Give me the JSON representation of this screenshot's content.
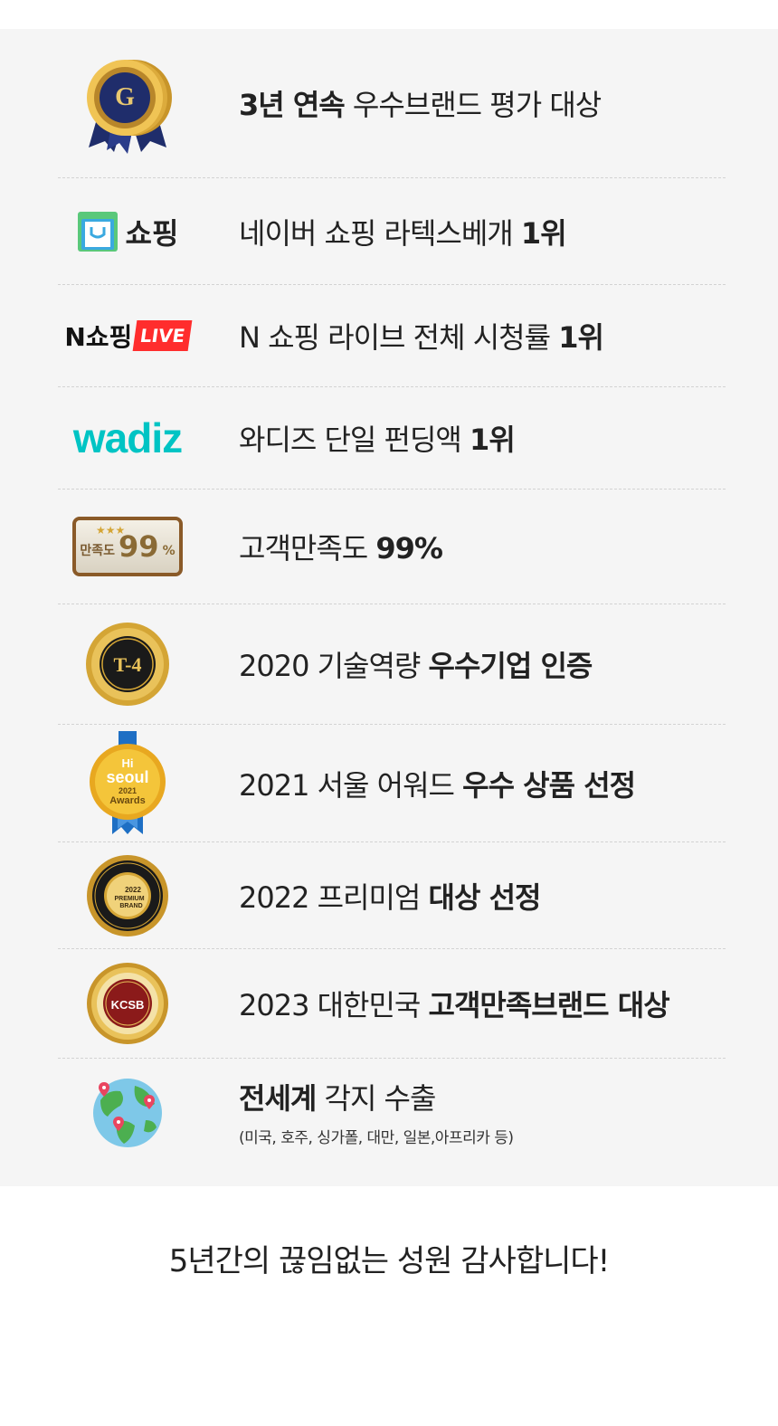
{
  "awards": [
    {
      "icon": "ksba-award-medal-icon",
      "plain_before": "",
      "bold_before": "3년 연속",
      "plain": " 우수브랜드 평가 대상",
      "bold": ""
    },
    {
      "icon": "naver-shopping-logo-icon",
      "icon_text": "쇼핑",
      "plain_before": "",
      "bold_before": "",
      "plain": "네이버 쇼핑 라텍스베개 ",
      "bold": "1위"
    },
    {
      "icon": "n-shopping-live-logo-icon",
      "icon_text": "N쇼핑",
      "icon_badge": "LIVE",
      "plain_before": "",
      "bold_before": "",
      "plain": "N 쇼핑 라이브 전체 시청률 ",
      "bold": "1위"
    },
    {
      "icon": "wadiz-logo-icon",
      "icon_text": "wadiz",
      "plain_before": "",
      "bold_before": "",
      "plain": "와디즈 단일 펀딩액 ",
      "bold": "1위"
    },
    {
      "icon": "satisfaction-99-badge-icon",
      "icon_text": "만족도",
      "icon_value": "99",
      "icon_unit": "%",
      "plain_before": "",
      "bold_before": "",
      "plain": "고객만족도 ",
      "bold": "99%"
    },
    {
      "icon": "t4-gold-seal-icon",
      "icon_text": "T-4",
      "plain_before": "",
      "bold_before": "",
      "plain": "2020 기술역량 ",
      "bold": "우수기업 인증"
    },
    {
      "icon": "hi-seoul-awards-medal-icon",
      "icon_text_1": "Hi",
      "icon_text_2": "seoul",
      "icon_text_3": "2021",
      "icon_text_4": "Awards",
      "plain_before": "",
      "bold_before": "",
      "plain": "2021 서울 어워드 ",
      "bold": "우수 상품 선정"
    },
    {
      "icon": "premium-brand-2022-seal-icon",
      "icon_text_1": "2022",
      "icon_text_2": "PREMIUM",
      "icon_text_3": "BRAND",
      "plain_before": "",
      "bold_before": "",
      "plain": "2022 프리미엄 ",
      "bold": "대상 선정"
    },
    {
      "icon": "kcsb-seal-icon",
      "icon_text": "KCSB",
      "plain_before": "",
      "bold_before": "",
      "plain": "2023 대한민국 ",
      "bold": "고객만족브랜드 대상"
    },
    {
      "icon": "globe-icon",
      "plain_before": "",
      "bold_before": "전세계",
      "plain": " 각지 수출",
      "bold": "",
      "note": "(미국, 호주, 싱가폴, 대만, 일본,아프리카 등)"
    }
  ],
  "footer": "5년간의 끊임없는 성원 감사합니다!",
  "colors": {
    "panel": "#f5f5f5",
    "wadiz": "#00c4c4",
    "live_red": "#ff2d2d",
    "gold": "#d4a535",
    "navy": "#1f2d6b",
    "kcsb_red": "#8b1a1a",
    "globe_blue": "#7ec8e8",
    "globe_green": "#4caf50"
  }
}
